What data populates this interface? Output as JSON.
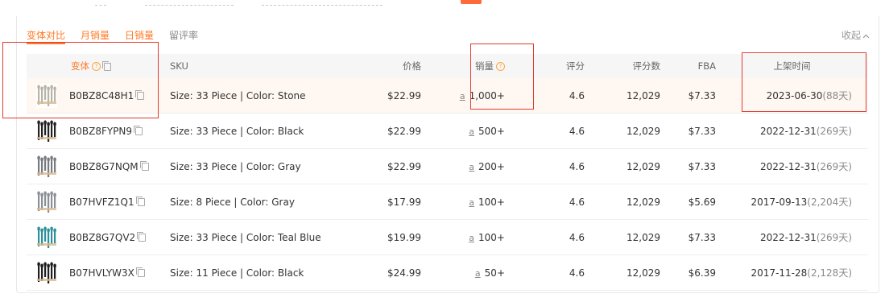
{
  "tabs": [
    {
      "label": "变体对比",
      "active": true
    },
    {
      "label": "月销量",
      "active": false
    },
    {
      "label": "日销量",
      "active": false
    },
    {
      "label": "留评率",
      "active": false
    }
  ],
  "collapse_label": "收起",
  "columns": {
    "variant": "变体",
    "sku": "SKU",
    "price": "价格",
    "sales": "销量",
    "rating": "评分",
    "reviews": "评分数",
    "fba": "FBA",
    "listed": "上架时间"
  },
  "rows": [
    {
      "asin": "B0BZ8C48H1",
      "sku": "Size: 33 Piece | Color: Stone",
      "price": "$22.99",
      "sales": "1,000+",
      "rating": "4.6",
      "reviews": "12,029",
      "fba": "$7.33",
      "date": "2023-06-30",
      "days": "(88天)",
      "thumb_color": "#b9b3a8"
    },
    {
      "asin": "B0BZ8FYPN9",
      "sku": "Size: 33 Piece | Color: Black",
      "price": "$22.99",
      "sales": "500+",
      "rating": "4.6",
      "reviews": "12,029",
      "fba": "$7.33",
      "date": "2022-12-31",
      "days": "(269天)",
      "thumb_color": "#222222"
    },
    {
      "asin": "B0BZ8G7NQM",
      "sku": "Size: 33 Piece | Color: Gray",
      "price": "$22.99",
      "sales": "200+",
      "rating": "4.6",
      "reviews": "12,029",
      "fba": "$7.33",
      "date": "2022-12-31",
      "days": "(269天)",
      "thumb_color": "#777b80"
    },
    {
      "asin": "B07HVFZ1Q1",
      "sku": "Size: 8 Piece | Color: Gray",
      "price": "$17.99",
      "sales": "100+",
      "rating": "4.6",
      "reviews": "12,029",
      "fba": "$5.69",
      "date": "2017-09-13",
      "days": "(2,204天)",
      "thumb_color": "#8a9096"
    },
    {
      "asin": "B0BZ8G7QV2",
      "sku": "Size: 33 Piece | Color: Teal Blue",
      "price": "$19.99",
      "sales": "100+",
      "rating": "4.6",
      "reviews": "12,029",
      "fba": "$7.33",
      "date": "2022-12-31",
      "days": "(269天)",
      "thumb_color": "#2f8f9a"
    },
    {
      "asin": "B07HVLYW3X",
      "sku": "Size: 11 Piece | Color: Black",
      "price": "$24.99",
      "sales": "50+",
      "rating": "4.6",
      "reviews": "12,029",
      "fba": "$6.39",
      "date": "2017-11-28",
      "days": "(2,128天)",
      "thumb_color": "#1f1f1f"
    }
  ],
  "colors": {
    "accent": "#ff7a26",
    "highlight_row": "#fff8f2",
    "annotation_box": "#e23a2f"
  },
  "icons": {
    "help": "help-circle-icon",
    "copy": "copy-icon",
    "amazon": "amazon-icon",
    "collapse": "chevron-up-icon"
  }
}
